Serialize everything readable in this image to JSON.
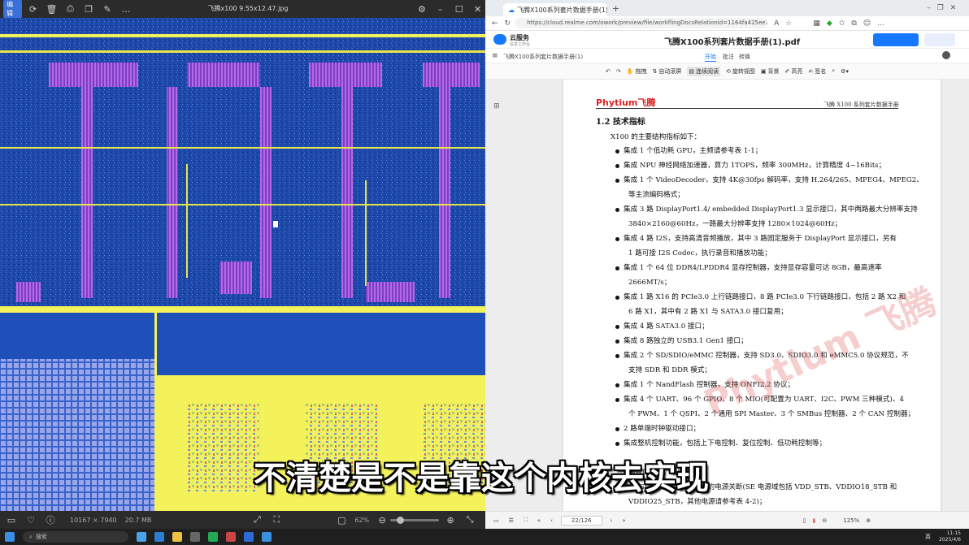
{
  "viewer": {
    "title": "飞腾x100 9.55x12.47.jpg",
    "mode_label": "编辑",
    "dims": "10167 × 7940",
    "filesize": "20.7 MB",
    "zoom": "62%"
  },
  "browser": {
    "tab_title": "飞腾X100系列套片数据手册(1).pd",
    "url": "https://cloud.realme.com/owork/preview/file/workflingDocsRelationId=1164fa425ee7f4419bdaadc3cc1d025",
    "app_name": "云服务",
    "app_sub": "信息工作台",
    "doc_title": "飞腾X100系列套片数据手册(1).pdf",
    "breadcrumb": "飞腾X100系列套片数据手册(1)",
    "menu": [
      "开始",
      "批注",
      "转换"
    ],
    "tools": [
      "拖拽",
      "自动滚屏",
      "连续阅读",
      "旋转视图",
      "背景",
      "高亮",
      "签名"
    ],
    "page_indicator": "22/126",
    "zoom": "125%"
  },
  "doc": {
    "logo": "Phytium飞腾",
    "header_right": "飞腾 X100 系列套片数据手册",
    "section": "1.2 技术指标",
    "intro": "X100 的主要结构指标如下：",
    "lines": [
      {
        "b": true,
        "text": "集成 1 个低功耗 GPU，主频请参考表  1-1；"
      },
      {
        "b": true,
        "text": "集成 NPU 神经网络加速器，算力 1TOPS，频率 300MHz，计算精度 4~16Bits；"
      },
      {
        "b": true,
        "text": "集成 1 个 VideoDecoder，支持 4K@30fps 解码率，支持 H.264/265、MPEG4、MPEG2、"
      },
      {
        "b": false,
        "text": "等主流编码格式；"
      },
      {
        "b": true,
        "text": "集成 3 路 DisplayPort1.4/ embedded DisplayPort1.3 显示接口，其中两路最大分辨率支持"
      },
      {
        "b": false,
        "text": "3840×2160@60Hz，一路最大分辨率支持 1280×1024@60Hz；"
      },
      {
        "b": true,
        "text": "集成 4 路 I2S，支持高清音频播放，其中 3 路固定服务于 DisplayPort 显示接口，另有"
      },
      {
        "b": false,
        "text": "1 路可接 I2S Codec，执行录音和播放功能；"
      },
      {
        "b": true,
        "text": "集成 1 个 64 位 DDR4/LPDDR4 显存控制器，支持显存容量可达 8GB，最高速率"
      },
      {
        "b": false,
        "text": "2666MT/s；"
      },
      {
        "b": true,
        "text": "集成 1 路 X16 的 PCIe3.0 上行链路接口，8 路 PCIe3.0 下行链路接口，包括 2 路 X2 和"
      },
      {
        "b": false,
        "text": "6 路 X1，其中有 2 路 X1 与 SATA3.0 接口复用；"
      },
      {
        "b": true,
        "text": "集成 4 路 SATA3.0 接口；"
      },
      {
        "b": true,
        "text": "集成 8 路独立的 USB3.1 Gen1 接口；"
      },
      {
        "b": true,
        "text": "集成 2 个 SD/SDIO/eMMC 控制器，支持 SD3.0、SDIO3.0 和 eMMC5.0 协议规范，不"
      },
      {
        "b": false,
        "text": "支持 SDR 和 DDR 模式；"
      },
      {
        "b": true,
        "text": "集成 1 个 NandFlash 控制器，支持 ONFI2.2 协议；"
      },
      {
        "b": true,
        "text": "集成 4 个 UART、96 个 GPIO、8 个 MIO(可配置为 UART、I2C、PWM 三种模式)、4"
      },
      {
        "b": false,
        "text": "个 PWM、1 个 QSPI、2 个通用 SPI Master、3 个 SMBus 控制器、2 个 CAN 控制器；"
      },
      {
        "b": true,
        "text": "2 路单端时钟驱动接口；"
      },
      {
        "b": true,
        "text": "集成整机控制功能，包括上下电控制、复位控制、低功耗控制等；"
      },
      {
        "b": false,
        "text": "测片内温度，精度±5℃。"
      },
      {
        "b": true,
        "text": "支持 SE 电源域以外所有域的电源关断(SE 电源域包括 VDD_STB、VDDIO18_STB 和"
      },
      {
        "b": false,
        "text": "VDDIO25_STB，其他电源请参考表  4-2)；"
      }
    ]
  },
  "watermark": "Phytium 飞腾",
  "subtitle": "不清楚是不是靠这个内核去实现",
  "taskbar": {
    "search_placeholder": "搜索",
    "time": "11:15",
    "date": "2025/4/6",
    "lang": "英"
  },
  "colors": {
    "die_blue": "#1f4fb8",
    "die_yellow": "#f4f25a",
    "die_purple": "#9b4fd1",
    "accent": "#1677ff"
  }
}
